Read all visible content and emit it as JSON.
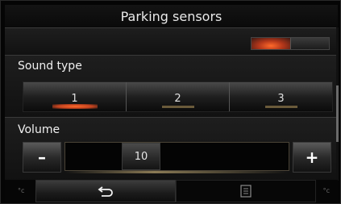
{
  "header": {
    "title": "Parking sensors"
  },
  "sensor_toggle": {
    "state": "on",
    "accent": "#ff6a2b"
  },
  "sound_type": {
    "label": "Sound type",
    "options": [
      "1",
      "2",
      "3"
    ],
    "selected": "1"
  },
  "volume": {
    "label": "Volume",
    "minus_label": "–",
    "plus_label": "+",
    "value": "10",
    "min": 0,
    "max": 10
  },
  "footer": {
    "left_label": "°c",
    "right_label": "°c",
    "back_icon": "return-arrow-icon",
    "menu_icon": "menu-list-icon"
  },
  "scroll": {
    "position": 0.6
  }
}
